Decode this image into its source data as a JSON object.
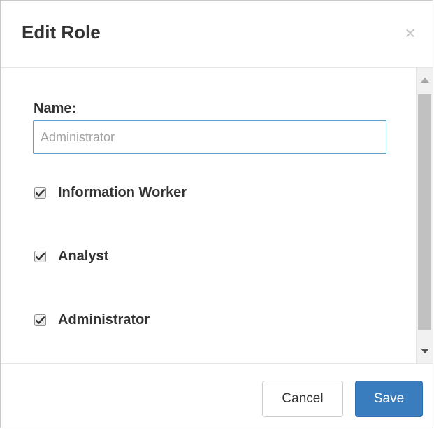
{
  "dialog": {
    "title": "Edit Role",
    "close_icon": "close-icon",
    "close_glyph": "×"
  },
  "form": {
    "name_label": "Name:",
    "name_value": "",
    "name_placeholder": "Administrator",
    "roles": [
      {
        "label": "Information Worker",
        "checked": true
      },
      {
        "label": "Analyst",
        "checked": true
      },
      {
        "label": "Administrator",
        "checked": true
      }
    ]
  },
  "footer": {
    "cancel_label": "Cancel",
    "save_label": "Save"
  },
  "colors": {
    "primary": "#3a7dbf",
    "input_border": "#5b9fd0",
    "text": "#333333"
  }
}
